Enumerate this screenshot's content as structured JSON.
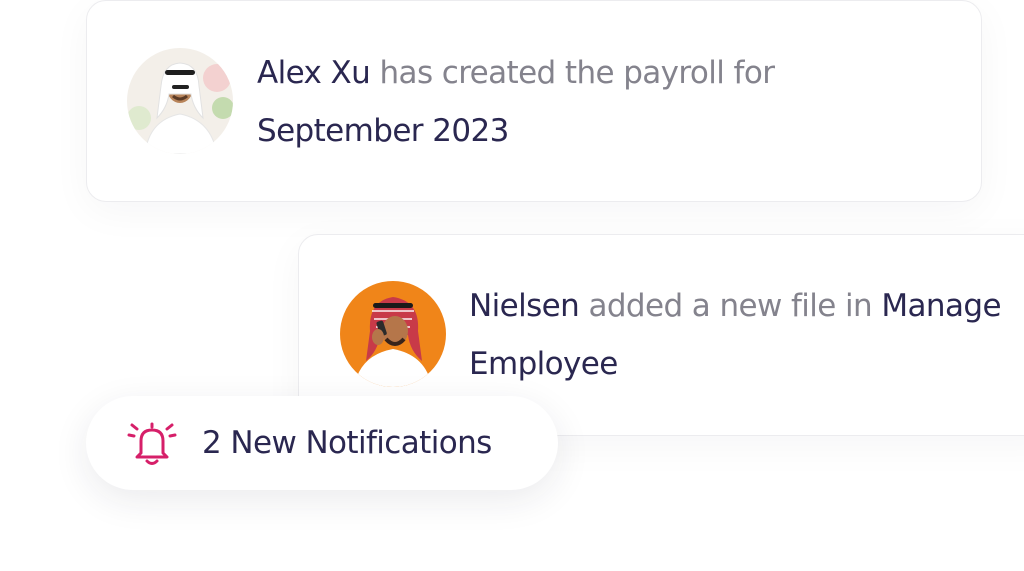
{
  "notifications": [
    {
      "actor": "Alex Xu",
      "action": "has created the payroll for",
      "object": "September 2023",
      "avatar_icon": "user-avatar-photo"
    },
    {
      "actor": "Nielsen",
      "action": "added a new file in",
      "object_line1": "Manage",
      "object_line2": "Employee",
      "avatar_icon": "user-avatar-photo"
    }
  ],
  "badge": {
    "text": "2 New Notifications",
    "icon": "bell-icon",
    "accent": "#d61f69"
  },
  "colors": {
    "strong_text": "#2a2750",
    "muted_text": "#84838d",
    "card_border": "#ececef"
  }
}
